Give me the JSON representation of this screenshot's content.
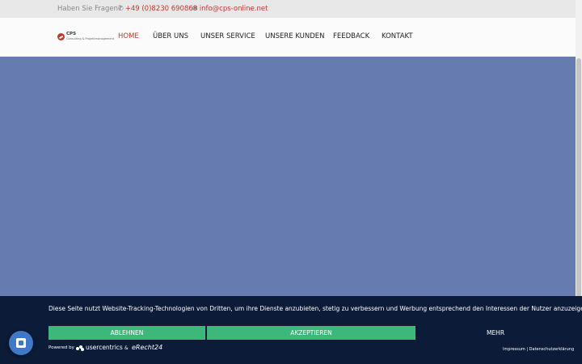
{
  "topbar": {
    "question": "Haben Sie Fragen?",
    "phone": "+49 (0)8230 690868",
    "email": "info@cps-online.net",
    "phone_icon": "phone-icon",
    "mail_icon": "mail-icon"
  },
  "logo": {
    "name": "CPS",
    "subtitle": "Consulting & Projektmanagement"
  },
  "nav": {
    "items": [
      "HOME",
      "ÜBER UNS",
      "UNSER SERVICE",
      "UNSERE KUNDEN",
      "FEEDBACK",
      "KONTAKT"
    ],
    "active": "HOME"
  },
  "cookie": {
    "message": "Diese Seite nutzt Website-Tracking-Technologien von Dritten, um ihre Dienste anzubieten, stetig zu verbessern und Werbung entsprechend den Interessen der Nutzer anzuzeigen.",
    "decline": "ABLEHNEN",
    "accept": "AKZEPTIEREN",
    "more": "MEHR",
    "powered_by": "Powered by",
    "usercentrics": "usercentrics",
    "and": "&",
    "erecht": "eRecht24",
    "imprint": "Impressum",
    "separator": "|",
    "privacy": "Datenschutzerklärung"
  },
  "colors": {
    "accent": "#c0392b",
    "hero": "#667bb0",
    "banner": "#0b1b38",
    "button_green": "#3bb87a",
    "fab": "#3e79c5"
  },
  "icons": {
    "fab": "chat-widget-icon"
  }
}
